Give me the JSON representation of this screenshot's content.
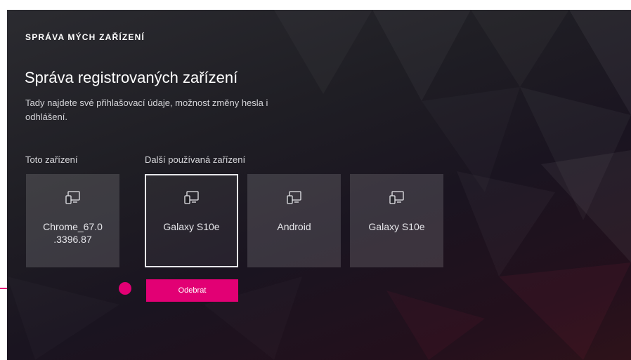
{
  "header": {
    "section_title": "SPRÁVA MÝCH ZAŘÍZENÍ",
    "page_title": "Správa registrovaných zařízení",
    "description": "Tady najdete své přihlašovací údaje, možnost změny hesla i odhlášení."
  },
  "groups": {
    "this_device_label": "Toto zařízení",
    "other_devices_label": "Další používaná zařízení"
  },
  "devices": [
    {
      "name": "Chrome_67.0 .3396.87",
      "icon": "device-icon",
      "group": "this",
      "selected": false
    },
    {
      "name": "Galaxy S10e",
      "icon": "device-icon",
      "group": "other",
      "selected": true
    },
    {
      "name": "Android",
      "icon": "device-icon",
      "group": "other",
      "selected": false
    },
    {
      "name": "Galaxy S10e",
      "icon": "device-icon",
      "group": "other",
      "selected": false
    }
  ],
  "actions": {
    "remove_label": "Odebrat"
  },
  "colors": {
    "accent": "#e20074",
    "text": "#ffffff",
    "tile": "#3a393f"
  }
}
